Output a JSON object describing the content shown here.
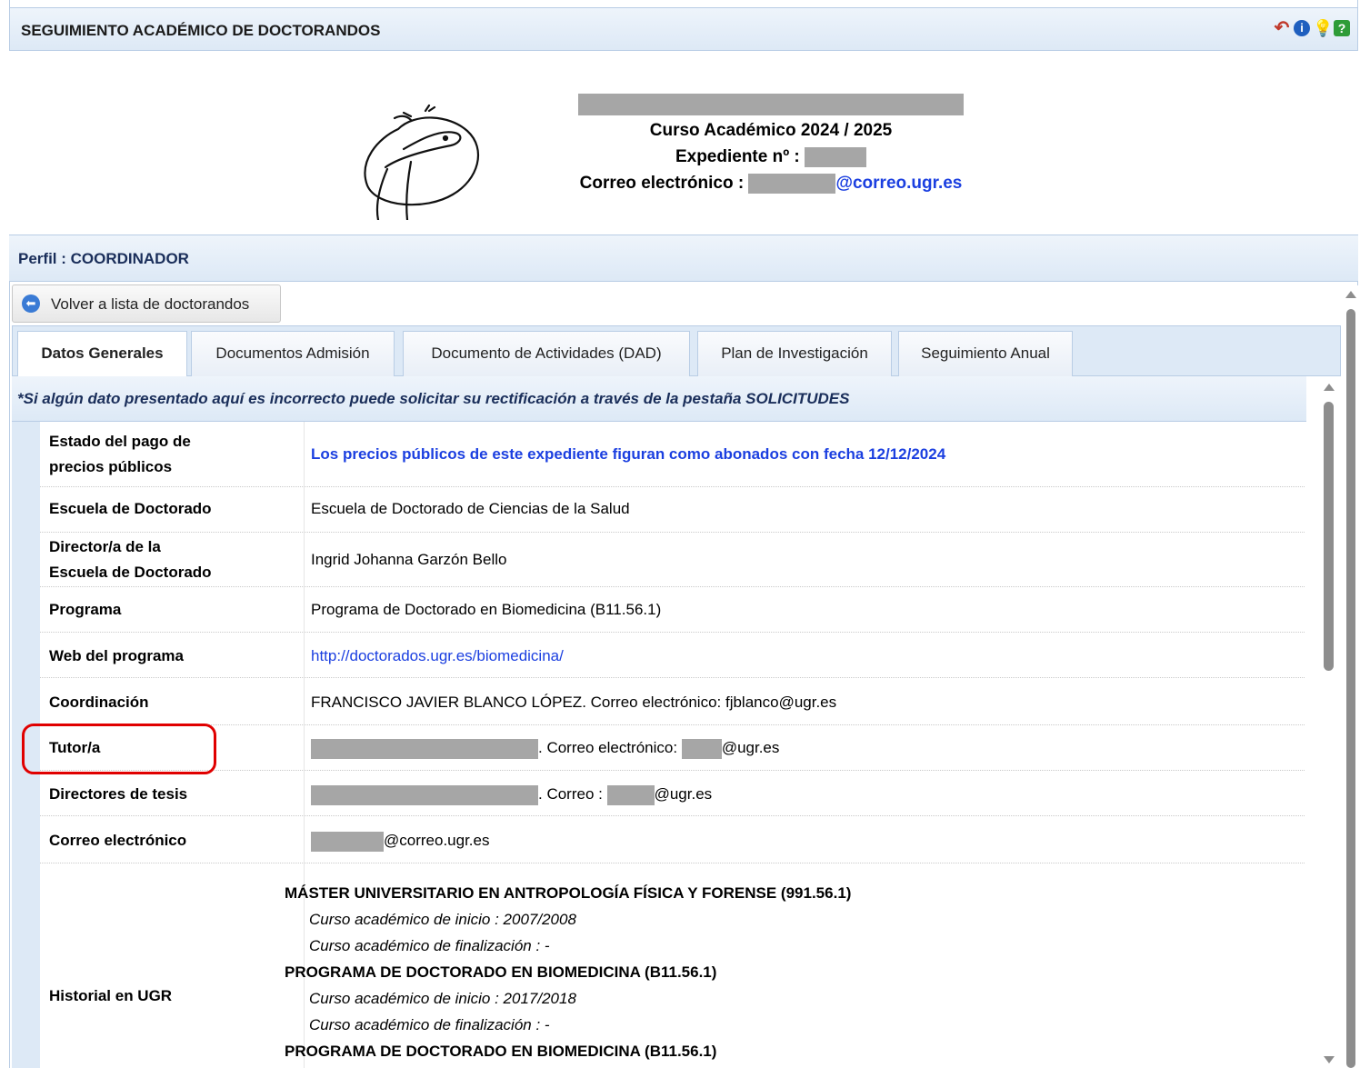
{
  "window": {
    "title": "SEGUIMIENTO ACADÉMICO DE DOCTORANDOS",
    "icons": [
      "back-icon",
      "info-icon",
      "bulb-icon",
      "help-icon"
    ],
    "icon_glyphs": {
      "back": "↶",
      "info": "i",
      "bulb": "💡",
      "help": "?"
    }
  },
  "header": {
    "course_label": "Curso Académico 2024 / 2025",
    "expediente_label": "Expediente nº :",
    "email_label": "Correo electrónico :",
    "email_domain": "@correo.ugr.es"
  },
  "profile": {
    "label": "Perfil : COORDINADOR"
  },
  "back_button": {
    "label": "Volver a lista de doctorandos",
    "icon": "back-arrow-icon"
  },
  "tabs": [
    {
      "label": "Datos Generales",
      "active": true
    },
    {
      "label": "Documentos Admisión",
      "active": false
    },
    {
      "label": "Documento de Actividades (DAD)",
      "active": false
    },
    {
      "label": "Plan de Investigación",
      "active": false
    },
    {
      "label": "Seguimiento Anual",
      "active": false
    }
  ],
  "notice": "*Si algún dato presentado aquí es incorrecto puede solicitar su rectificación a través de la pestaña SOLICITUDES",
  "rows": {
    "pago": {
      "key_line1": "Estado del pago de",
      "key_line2": "precios públicos",
      "value": "Los precios públicos de este expediente figuran como abonados con fecha 12/12/2024"
    },
    "escuela": {
      "key": "Escuela de Doctorado",
      "value": "Escuela de Doctorado de Ciencias de la Salud"
    },
    "director": {
      "key_line1": "Director/a de la",
      "key_line2": "Escuela de Doctorado",
      "value": "Ingrid Johanna Garzón Bello"
    },
    "programa": {
      "key": "Programa",
      "value": "Programa de Doctorado en Biomedicina (B11.56.1)"
    },
    "web": {
      "key": "Web del programa",
      "value": "http://doctorados.ugr.es/biomedicina/"
    },
    "coordinacion": {
      "key": "Coordinación",
      "value": "FRANCISCO JAVIER BLANCO LÓPEZ. Correo electrónico: fjblanco@ugr.es"
    },
    "tutor": {
      "key": "Tutor/a",
      "mid": ". Correo electrónico:",
      "domain": "@ugr.es"
    },
    "directores": {
      "key": "Directores de tesis",
      "mid": ". Correo :",
      "domain": "@ugr.es"
    },
    "correo": {
      "key": "Correo electrónico",
      "domain": "@correo.ugr.es"
    },
    "historial": {
      "key": "Historial en UGR"
    }
  },
  "historial": [
    {
      "program": "MÁSTER UNIVERSITARIO EN ANTROPOLOGÍA FÍSICA Y FORENSE (991.56.1)",
      "inicio": "Curso académico de inicio : 2007/2008",
      "fin": "Curso académico de finalización : -"
    },
    {
      "program": "PROGRAMA DE DOCTORADO EN BIOMEDICINA (B11.56.1)",
      "inicio": "Curso académico de inicio : 2017/2018",
      "fin": "Curso académico de finalización : -"
    },
    {
      "program": "PROGRAMA DE DOCTORADO EN BIOMEDICINA (B11.56.1)"
    }
  ]
}
